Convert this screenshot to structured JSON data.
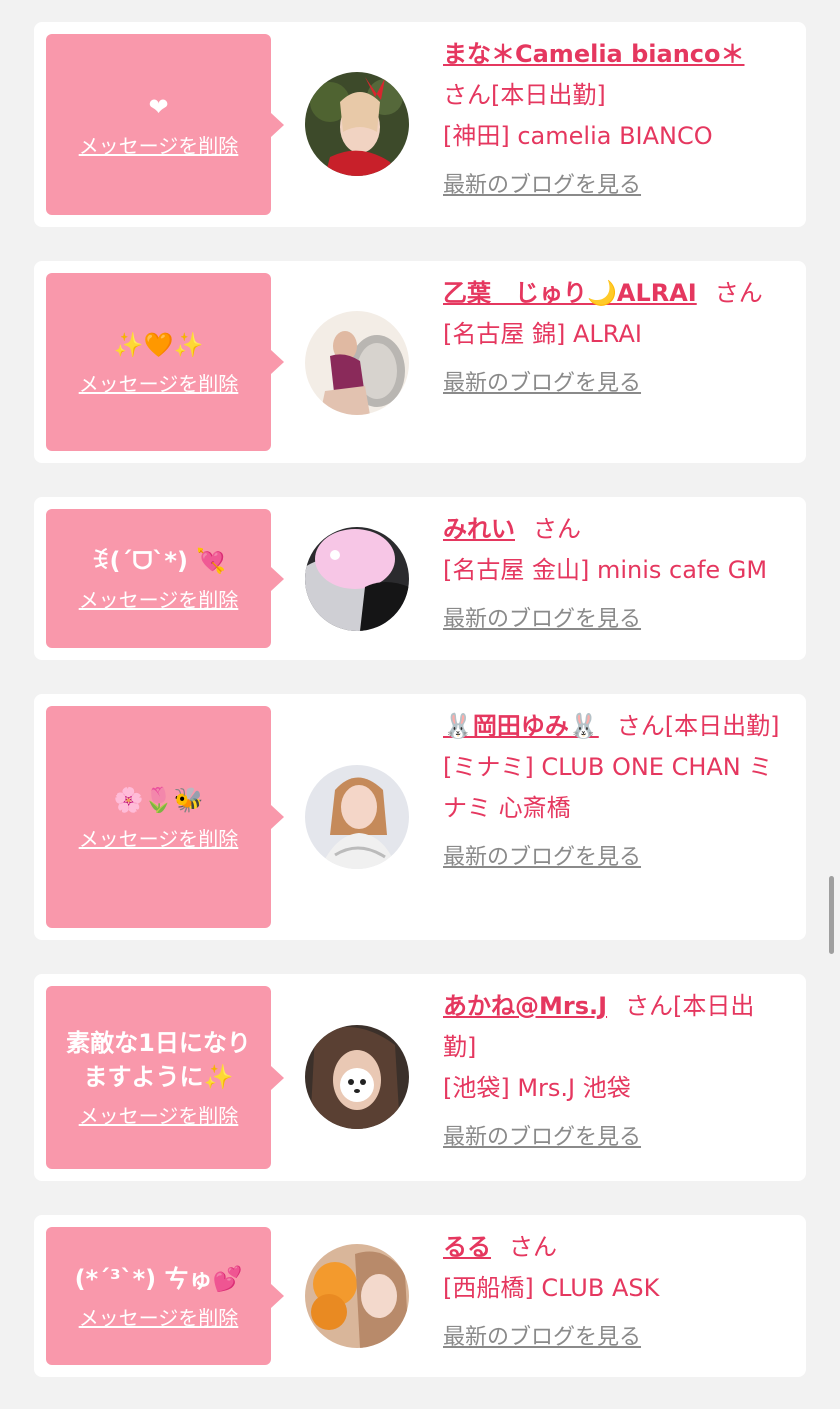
{
  "cards": [
    {
      "message": "❤",
      "delete_label": "メッセージを削除",
      "name": "まな＊Camelia bianco＊",
      "san": "さん[本日出勤]",
      "shop": "[神田] camelia BIANCO",
      "blog_label": "最新のブログを見る"
    },
    {
      "message": "✨🧡✨",
      "delete_label": "メッセージを削除",
      "name": "乙葉　じゅり🌙ALRAI",
      "san": "さん",
      "shop": "[名古屋 錦] ALRAI",
      "blog_label": "最新のブログを見る"
    },
    {
      "message": "ꉂ(ˊᗜˋ*) 💘",
      "delete_label": "メッセージを削除",
      "name": "みれい",
      "san": "さん",
      "shop": "[名古屋 金山] minis cafe GM",
      "blog_label": "最新のブログを見る"
    },
    {
      "message": "🌸🌷🐝",
      "delete_label": "メッセージを削除",
      "name": "🐰岡田ゆみ🐰",
      "san": "さん[本日出勤]",
      "shop": "[ミナミ] CLUB ONE CHAN ミナミ 心斎橋",
      "blog_label": "最新のブログを見る"
    },
    {
      "message": "素敵な1日になりますように✨",
      "delete_label": "メッセージを削除",
      "name": "あかね@Mrs.J",
      "san": "さん[本日出勤]",
      "shop": "[池袋] Mrs.J 池袋",
      "blog_label": "最新のブログを見る"
    },
    {
      "message": "(*´³`*) ㄘゅ💕",
      "delete_label": "メッセージを削除",
      "name": "るる",
      "san": "さん",
      "shop": "[西船橋] CLUB ASK",
      "blog_label": "最新のブログを見る"
    }
  ],
  "colors": {
    "accent": "#e5375f",
    "bubble": "#f998ab",
    "background": "#f2f2f2",
    "card": "#ffffff",
    "muted": "#8a8a8a"
  }
}
